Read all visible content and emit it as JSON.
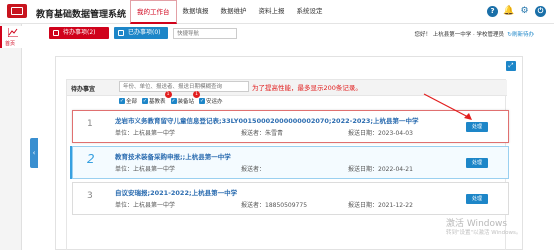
{
  "app": {
    "title": "教育基础数据管理系统"
  },
  "nav": [
    {
      "label": "我的工作台",
      "active": true
    },
    {
      "label": "数据填报",
      "active": false
    },
    {
      "label": "数据维护",
      "active": false
    },
    {
      "label": "资料上报",
      "active": false
    },
    {
      "label": "系统设定",
      "active": false
    }
  ],
  "top_icons": [
    "help-icon",
    "bell-icon",
    "settings-icon",
    "logout-icon"
  ],
  "rail": {
    "label": "首页"
  },
  "toolbar": {
    "pending_label": "待办事项(2)",
    "done_label": "已办事项(0)",
    "quick_nav_placeholder": "快捷导航",
    "greeting": "您好！ 上杭县第一中学 · 学校管理员",
    "refresh": "刷新待办"
  },
  "todo": {
    "title": "待办事宜",
    "search_placeholder": "年份、单位、报送者、报送日期模糊查询",
    "notice": "为了提高性能，最多显示200条记录。",
    "filters": [
      {
        "label": "全部",
        "badge": ""
      },
      {
        "label": "基教表",
        "badge": "1"
      },
      {
        "label": "装备站",
        "badge": "1"
      },
      {
        "label": "安运办",
        "badge": ""
      }
    ],
    "handle_label": "处理",
    "items": [
      {
        "num": "1",
        "title": "龙岩市义务教育留守儿童信息登记表;33LY00150002000000002070;2022-2023;上杭县第一中学",
        "unit_label": "单位：",
        "unit": "上杭县第一中学",
        "reporter_label": "报送者：",
        "reporter": "朱雪青",
        "date_label": "报送日期：",
        "date": "2023-04-03"
      },
      {
        "num": "2",
        "title": "教育技术装备采购申报;;上杭县第一中学",
        "unit_label": "单位：",
        "unit": "上杭县第一中学",
        "reporter_label": "报送者：",
        "reporter": "",
        "date_label": "报送日期：",
        "date": "2022-04-21"
      },
      {
        "num": "3",
        "title": "自议安瑞报;2021-2022;上杭县第一中学",
        "unit_label": "单位：",
        "unit": "上杭县第一中学",
        "reporter_label": "报送者：",
        "reporter": "18850509775",
        "date_label": "报送日期：",
        "date": "2021-12-22"
      }
    ]
  },
  "watermark": {
    "line1": "激活 Windows",
    "line2": "转到\"设置\"以激活 Windows。"
  },
  "colors": {
    "brand_red": "#d0021b",
    "accent_blue": "#1d86c8"
  }
}
